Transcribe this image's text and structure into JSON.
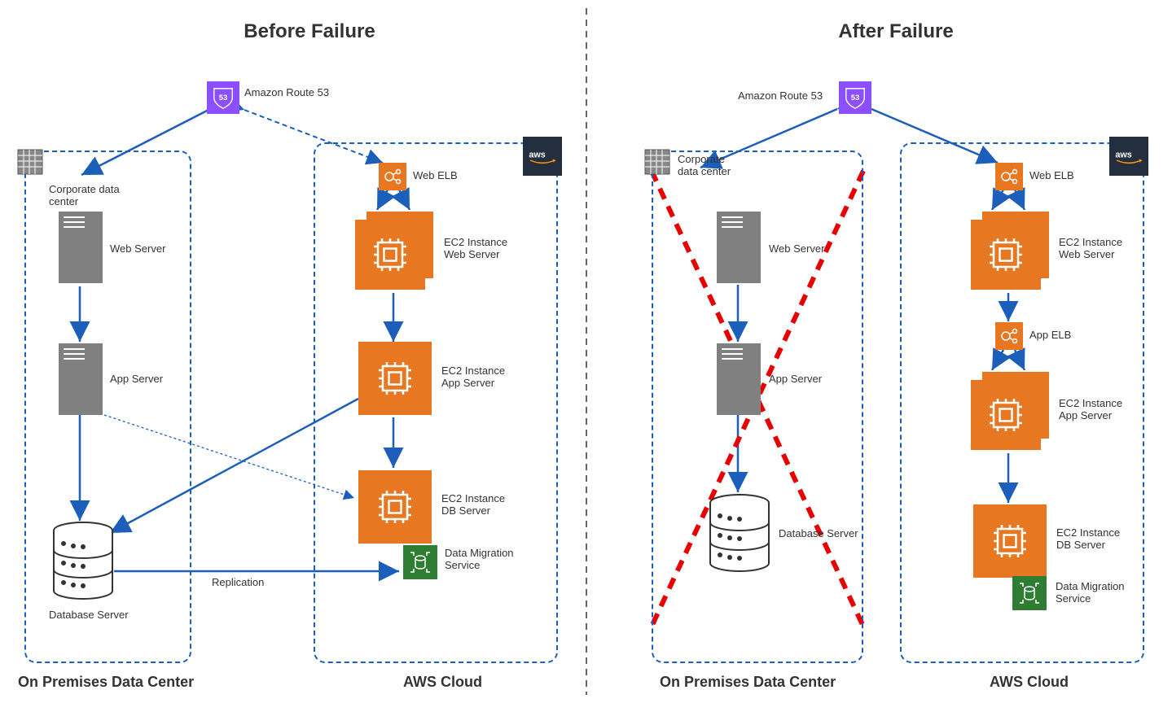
{
  "titles": {
    "before": "Before Failure",
    "after": "After Failure"
  },
  "labels": {
    "onprem": "On Premises Data Center",
    "aws_cloud": "AWS Cloud",
    "route53": "Amazon Route 53",
    "dc": "Corporate data center",
    "web": "Web Server",
    "app": "App Server",
    "db": "Database Server",
    "elb_web": "Web ELB",
    "ec2_web": "EC2 Instance\nWeb Server",
    "elb_app": "App ELB",
    "ec2_app": "EC2 Instance\nApp Server",
    "ec2_db": "EC2 Instance\nDB Server",
    "dms": "Data Migration\nService",
    "replication": "Replication"
  },
  "icons": {
    "route53_badge": "53"
  }
}
